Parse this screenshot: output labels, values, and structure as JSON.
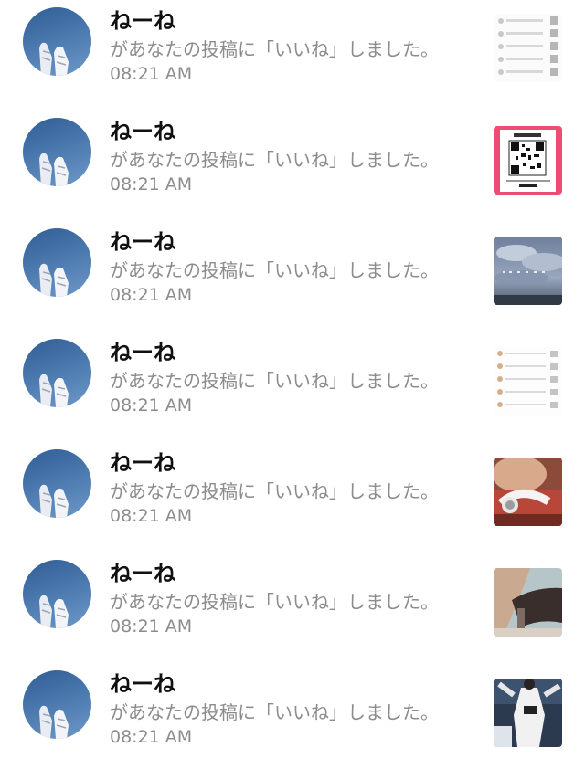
{
  "notifications": [
    {
      "name": "ねーね",
      "message": "があなたの投稿に「いいね」しました。",
      "time": "08:21 AM",
      "thumb_icon": "list-screenshot-thumbnail"
    },
    {
      "name": "ねーね",
      "message": "があなたの投稿に「いいね」しました。",
      "time": "08:21 AM",
      "thumb_icon": "qr-code-thumbnail"
    },
    {
      "name": "ねーね",
      "message": "があなたの投稿に「いいね」しました。",
      "time": "08:21 AM",
      "thumb_icon": "cloudy-sky-thumbnail"
    },
    {
      "name": "ねーね",
      "message": "があなたの投稿に「いいね」しました。",
      "time": "08:21 AM",
      "thumb_icon": "chat-list-thumbnail"
    },
    {
      "name": "ねーね",
      "message": "があなたの投稿に「いいね」しました。",
      "time": "08:21 AM",
      "thumb_icon": "headphones-photo-thumbnail"
    },
    {
      "name": "ねーね",
      "message": "があなたの投稿に「いいね」しました。",
      "time": "08:21 AM",
      "thumb_icon": "hair-photo-thumbnail"
    },
    {
      "name": "ねーね",
      "message": "があなたの投稿に「いいね」しました。",
      "time": "08:21 AM",
      "thumb_icon": "baseball-photo-thumbnail"
    }
  ],
  "avatar_icon": "sneakers-sky-avatar",
  "colors": {
    "name": "#111111",
    "secondary": "#8c8c8c",
    "avatar_sky": "#3d6aa2"
  }
}
